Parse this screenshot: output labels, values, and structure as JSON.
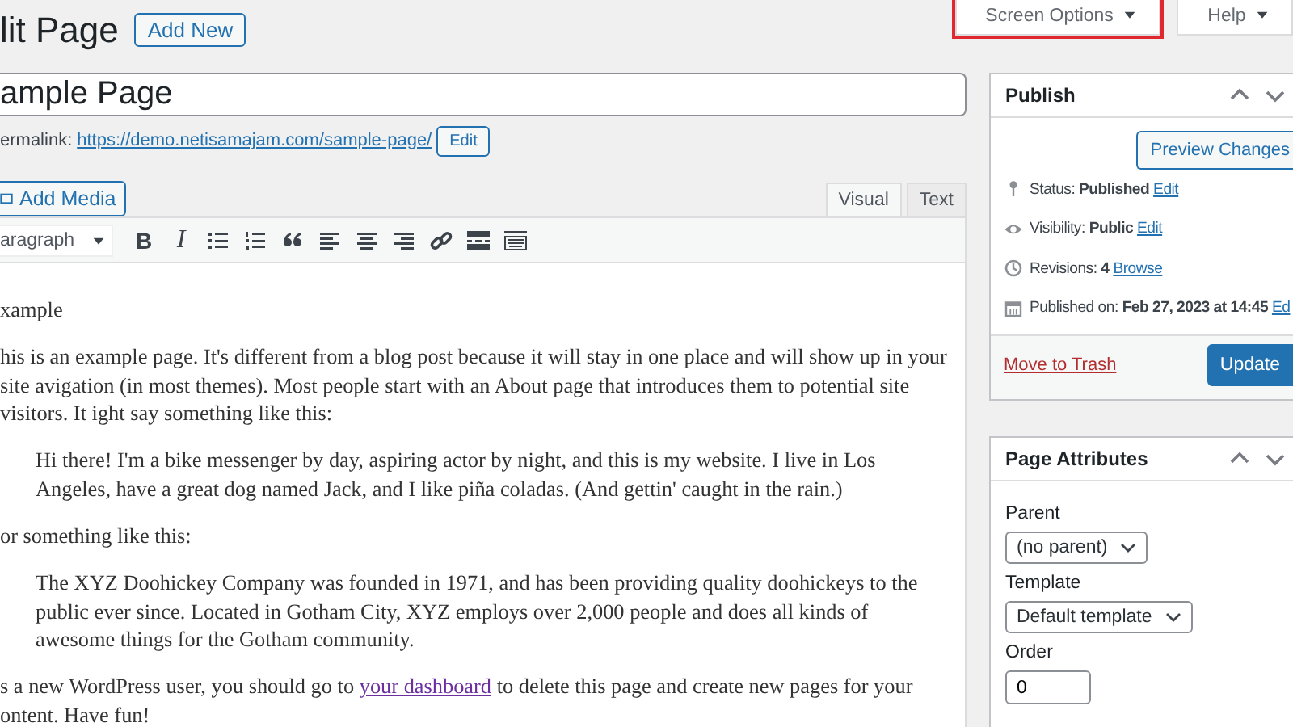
{
  "heading": {
    "title": "lit Page",
    "add_new": "Add New"
  },
  "screen_meta": [
    {
      "label": "Screen Options",
      "highlighted": true
    },
    {
      "label": "Help",
      "highlighted": false
    }
  ],
  "post_title": {
    "value": "ample Page"
  },
  "permalink": {
    "label": "ermalink:",
    "url": "https://demo.netisamajam.com/sample-page/",
    "edit": "Edit"
  },
  "add_media": "Add Media",
  "editor_tabs": [
    {
      "label": "Visual",
      "selected": true
    },
    {
      "label": "Text",
      "selected": false
    }
  ],
  "toolbar": {
    "format": "aragraph",
    "bold": "B",
    "italic": "I"
  },
  "content": [
    {
      "kind": "p",
      "text": "xample"
    },
    {
      "kind": "p",
      "text": "his is an example page. It's different from a blog post because it will stay in one place and will show up in your site avigation (in most themes). Most people start with an About page that introduces them to potential site visitors. It ight say something like this:"
    },
    {
      "kind": "quote",
      "text": "Hi there! I'm a bike messenger by day, aspiring actor by night, and this is my website. I live in Los Angeles, have a great dog named Jack, and I like piña coladas. (And gettin' caught in the rain.)"
    },
    {
      "kind": "p",
      "text": "or something like this:"
    },
    {
      "kind": "quote",
      "text": "The XYZ Doohickey Company was founded in 1971, and has been providing quality doohickeys to the public ever since. Located in Gotham City, XYZ employs over 2,000 people and does all kinds of awesome things for the Gotham community."
    },
    {
      "kind": "link",
      "text": "s a new WordPress user, you should go to ",
      "link": "your dashboard",
      "after": " to delete this page and create new pages for your ontent. Have fun!"
    }
  ],
  "publish": {
    "title": "Publish",
    "preview": "Preview Changes",
    "rows": [
      {
        "kind": "pin",
        "label": "Status: **Published**",
        "action": "Edit"
      },
      {
        "kind": "eye",
        "label": "Visibility: **Public**",
        "action": "Edit"
      },
      {
        "kind": "clock",
        "label": "Revisions: **4**",
        "action": "Browse"
      },
      {
        "kind": "calendar",
        "label": "Published on: **Feb 27, 2023 at 14:45**",
        "action": "Ed"
      }
    ],
    "trash": "Move to Trash",
    "update": "Update"
  },
  "attributes": {
    "title": "Page Attributes",
    "parent_label": "Parent",
    "parent": "(no parent)",
    "template_label": "Template",
    "template": "Default template",
    "order_label": "Order",
    "order": "0"
  }
}
